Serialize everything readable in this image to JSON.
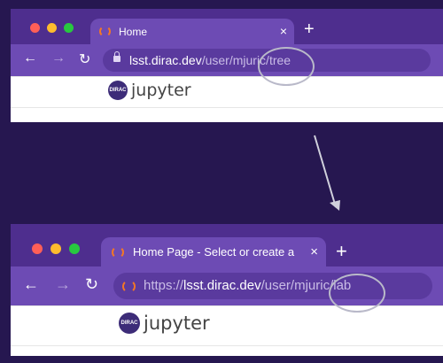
{
  "windows": [
    {
      "tab": {
        "title": "Home",
        "close": "×"
      },
      "new_tab": "+",
      "nav": {
        "back": "←",
        "forward": "→",
        "reload": "↻"
      },
      "url": {
        "scheme": "",
        "host": "lsst.dirac.dev",
        "path": "/user/mjuric/tree"
      },
      "logo": {
        "mark": "DIRAC",
        "text": "jupyter"
      }
    },
    {
      "tab": {
        "title": "Home Page - Select or create a",
        "close": "×"
      },
      "new_tab": "+",
      "nav": {
        "back": "←",
        "forward": "→",
        "reload": "↻"
      },
      "url": {
        "scheme": "https://",
        "host": "lsst.dirac.dev",
        "path": "/user/mjuric/lab"
      },
      "logo": {
        "mark": "DIRAC",
        "text": "jupyter"
      }
    }
  ],
  "colors": {
    "background": "#261750",
    "browser_chrome": "#4e2e8e",
    "active_tab": "#6d4bb4",
    "spinner": "#f37726",
    "highlight_circle": "#b9b9c9"
  }
}
